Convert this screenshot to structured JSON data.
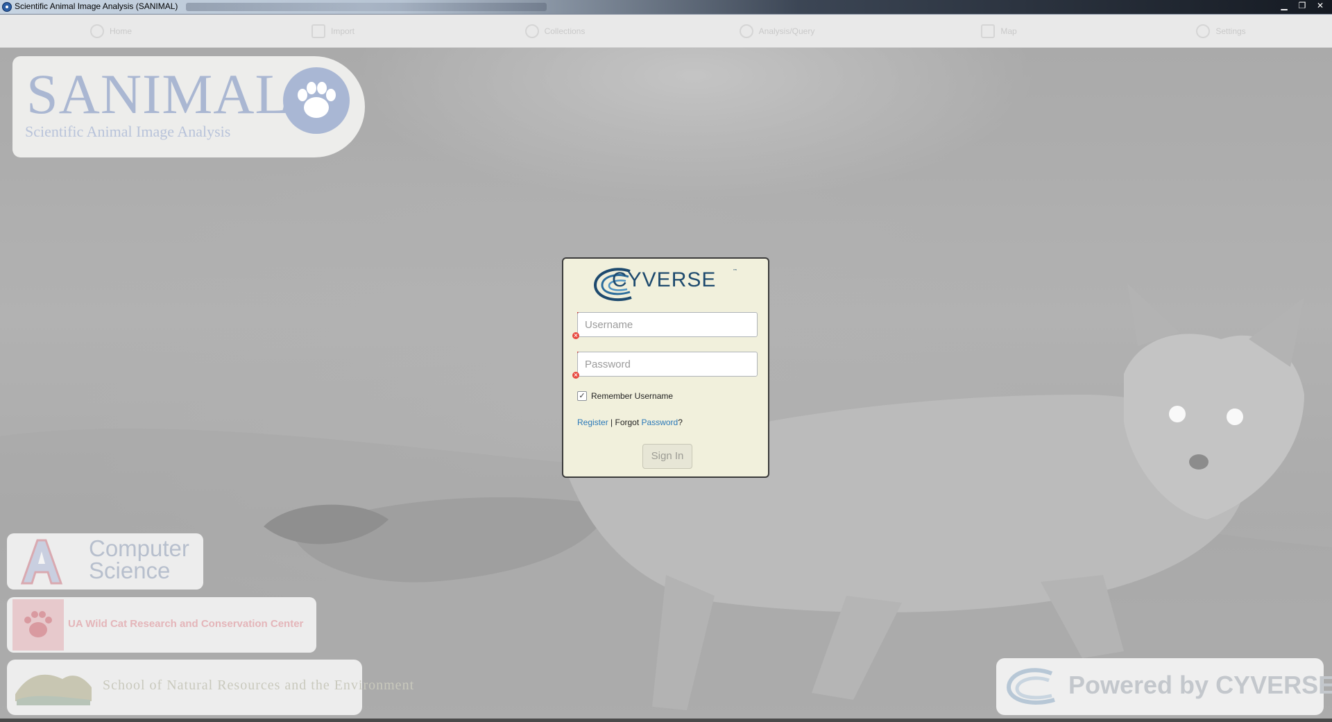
{
  "window": {
    "title": "Scientific Animal Image Analysis (SANIMAL)",
    "controls": {
      "minimize": "▁",
      "restore": "❐",
      "close": "✕"
    }
  },
  "tabs": [
    {
      "label": "Home",
      "icon": "home-icon"
    },
    {
      "label": "Import",
      "icon": "import-icon"
    },
    {
      "label": "Collections",
      "icon": "collections-icon"
    },
    {
      "label": "Analysis/Query",
      "icon": "search-icon"
    },
    {
      "label": "Map",
      "icon": "map-icon"
    },
    {
      "label": "Settings",
      "icon": "gear-icon"
    }
  ],
  "logos": {
    "sanimal": {
      "word": "SANIMAL",
      "subtitle": "Scientific Animal Image Analysis",
      "icon": "paw-icon",
      "color": "#a9b7d4"
    },
    "computer_science": {
      "line1": "Computer",
      "line2": "Science"
    },
    "wild_cat": {
      "text": "UA Wild Cat Research and Conservation Center"
    },
    "snre": {
      "text": "School of Natural Resources and the Environment"
    },
    "powered_by": {
      "text": "Powered by CYVERSE"
    }
  },
  "login": {
    "brand": "CYVERSE",
    "trademark": "™",
    "username_placeholder": "Username",
    "password_placeholder": "Password",
    "username_value": "",
    "password_value": "",
    "remember_label": "Remember Username",
    "remember_checked": true,
    "register_link": "Register",
    "separator": "|",
    "forgot_text": "Forgot",
    "password_link": "Password",
    "question_mark": "?",
    "signin_label": "Sign In",
    "colors": {
      "panel": "#f1f0dc",
      "brand": "#1e4a6e",
      "link": "#2a78b8",
      "error": "#e8483e"
    }
  }
}
